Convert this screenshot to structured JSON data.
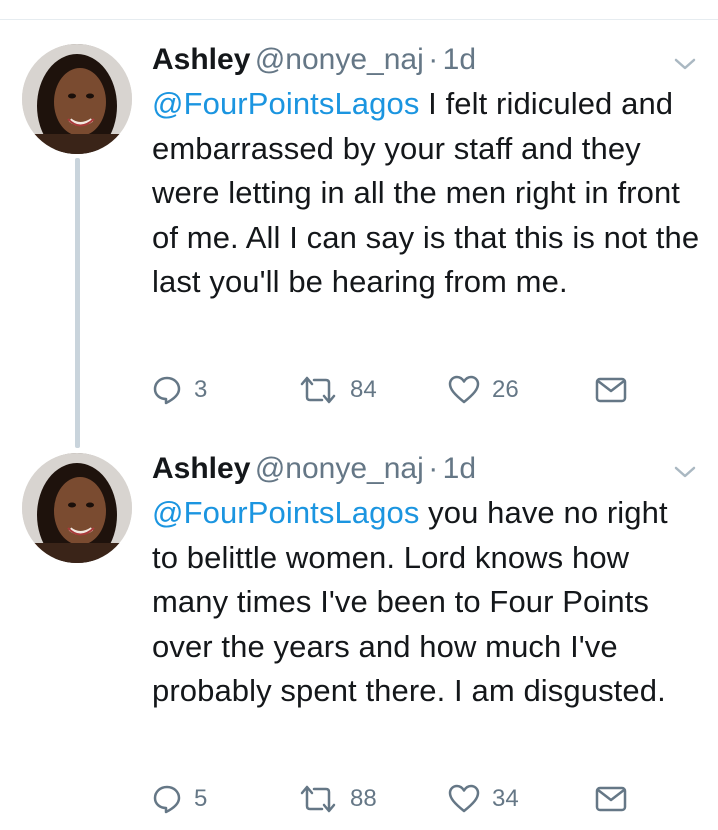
{
  "tweets": [
    {
      "author_name": "Ashley",
      "handle": "@nonye_naj",
      "separator": "·",
      "time": "1d",
      "mention": "@FourPointsLagos",
      "text": " I felt ridiculed and embarrassed by your staff and they were letting in all the men right in front of me. All I can say is that this is not the last you'll be hearing from me.",
      "reply_count": "3",
      "retweet_count": "84",
      "like_count": "26"
    },
    {
      "author_name": "Ashley",
      "handle": "@nonye_naj",
      "separator": "·",
      "time": "1d",
      "mention": "@FourPointsLagos",
      "text": " you have no right to belittle women. Lord knows how many times I've been to Four Points over the years and how much I've probably spent there. I am disgusted.",
      "reply_count": "5",
      "retweet_count": "88",
      "like_count": "34"
    }
  ],
  "colors": {
    "link": "#1b95e0",
    "secondary_text": "#657786",
    "thread_line": "#c9d4dc"
  },
  "icons": [
    "reply-icon",
    "retweet-icon",
    "like-icon",
    "direct-message-icon",
    "chevron-down-icon"
  ]
}
